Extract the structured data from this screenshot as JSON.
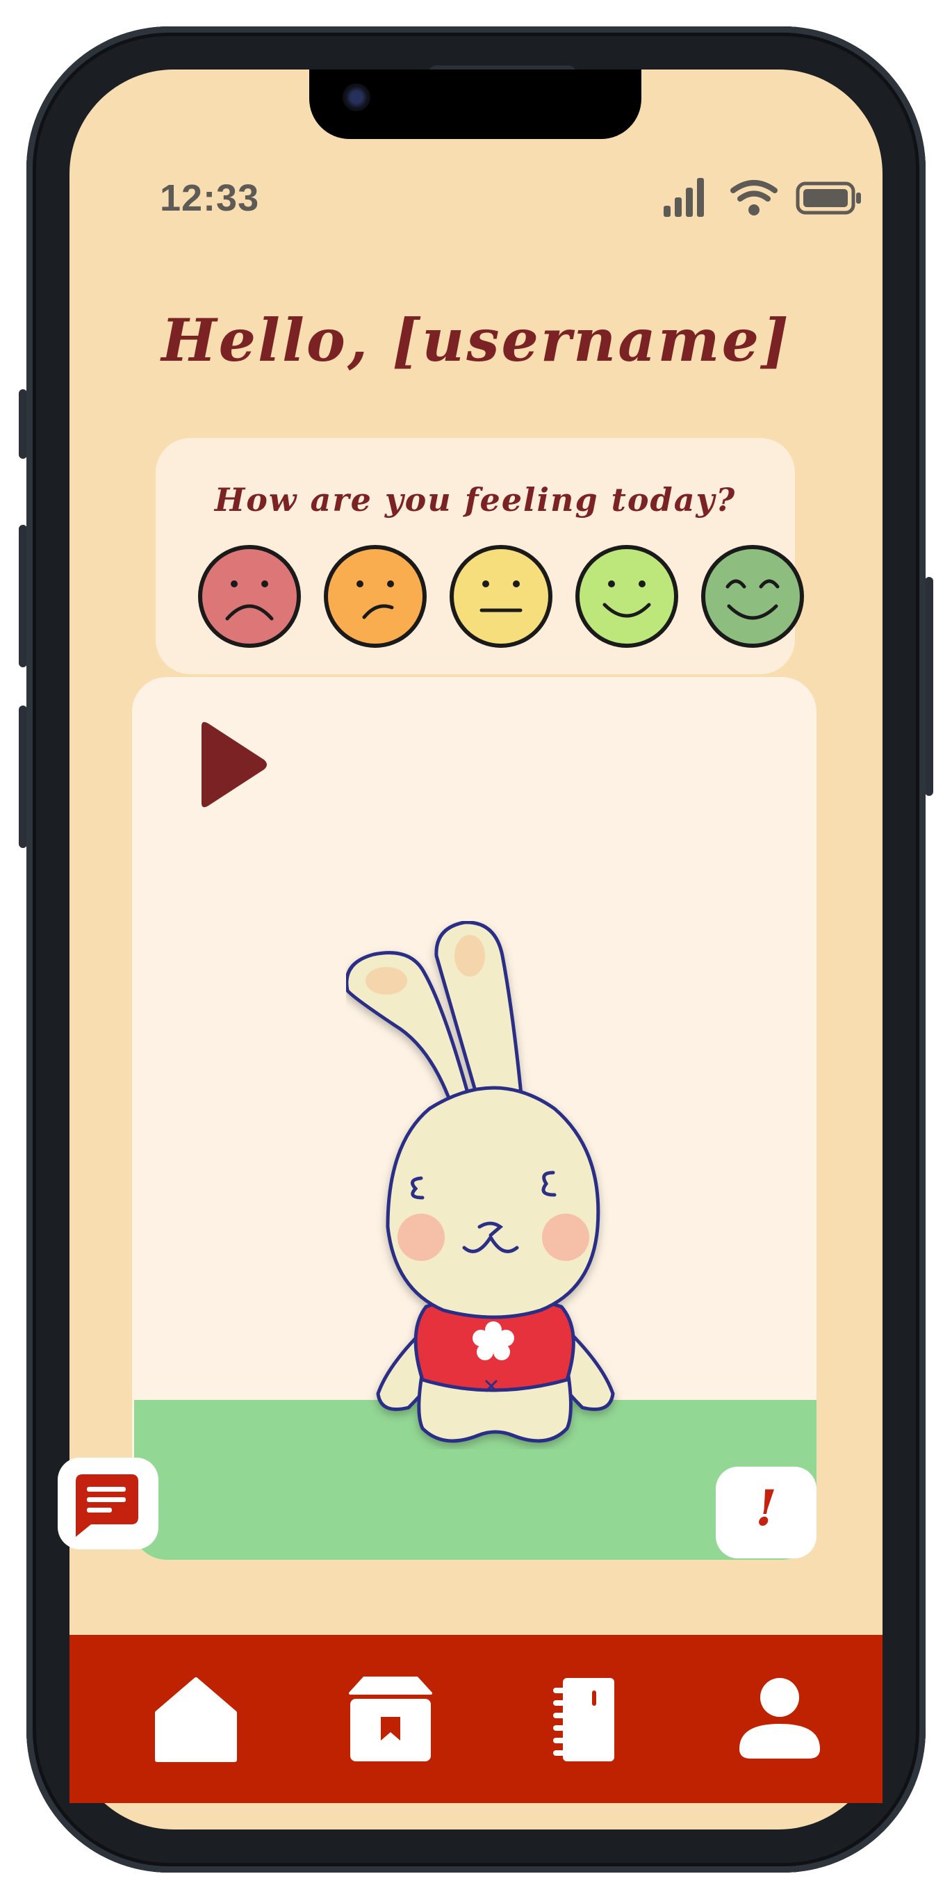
{
  "status_bar": {
    "time": "12:33",
    "icons": [
      "cellular-signal-icon",
      "wifi-icon",
      "battery-icon"
    ]
  },
  "greeting": "Hello, [username]",
  "mood": {
    "question": "How are you feeling today?",
    "options": [
      {
        "name": "very-sad",
        "color": "#dd7777"
      },
      {
        "name": "sad",
        "color": "#f9ad4f"
      },
      {
        "name": "neutral",
        "color": "#f6de7c"
      },
      {
        "name": "happy",
        "color": "#bde77a"
      },
      {
        "name": "very-happy",
        "color": "#8dbe7f"
      }
    ]
  },
  "play_area": {
    "play_icon": "play-icon",
    "character": "bunny-character",
    "background_color": "#fdf2e3",
    "ground_color": "#93d794"
  },
  "floating_actions": {
    "chat_icon": "chat-icon",
    "alert_label": "!"
  },
  "nav": {
    "background_color": "#be2200",
    "items": [
      {
        "icon": "home-icon"
      },
      {
        "icon": "store-icon"
      },
      {
        "icon": "notebook-icon"
      },
      {
        "icon": "profile-icon"
      }
    ]
  },
  "colors": {
    "screen_background": "#f8ddb0",
    "card_background": "#fdeedb",
    "accent_text": "#7a2224"
  }
}
